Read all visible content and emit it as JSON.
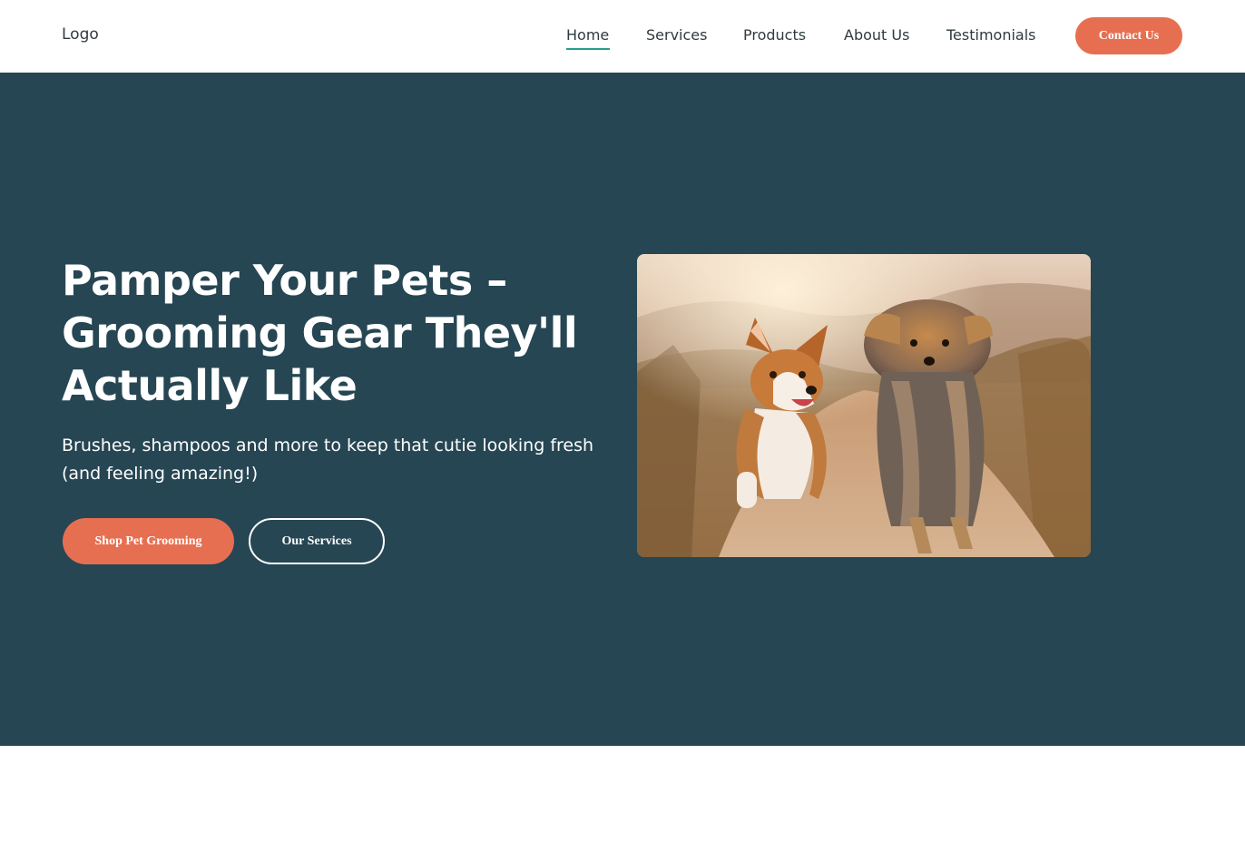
{
  "header": {
    "logo": "Logo",
    "nav": {
      "home": "Home",
      "services": "Services",
      "products": "Products",
      "about": "About Us",
      "testimonials": "Testimonials"
    },
    "active_item": "Home",
    "contact_label": "Contact Us"
  },
  "hero": {
    "title": "Pamper Your Pets – Grooming Gear They'll Actually Like",
    "subtitle": "Brushes, shampoos and more to keep that cutie looking fresh (and feeling amazing!)",
    "primary_button": "Shop Pet Grooming",
    "secondary_button": "Our Services",
    "image_icon": "dogs-photo"
  },
  "colors": {
    "accent": "#e76f51",
    "hero_background": "#264653",
    "active_underline": "#2a9d8f",
    "nav_text": "#2f3a3f"
  }
}
